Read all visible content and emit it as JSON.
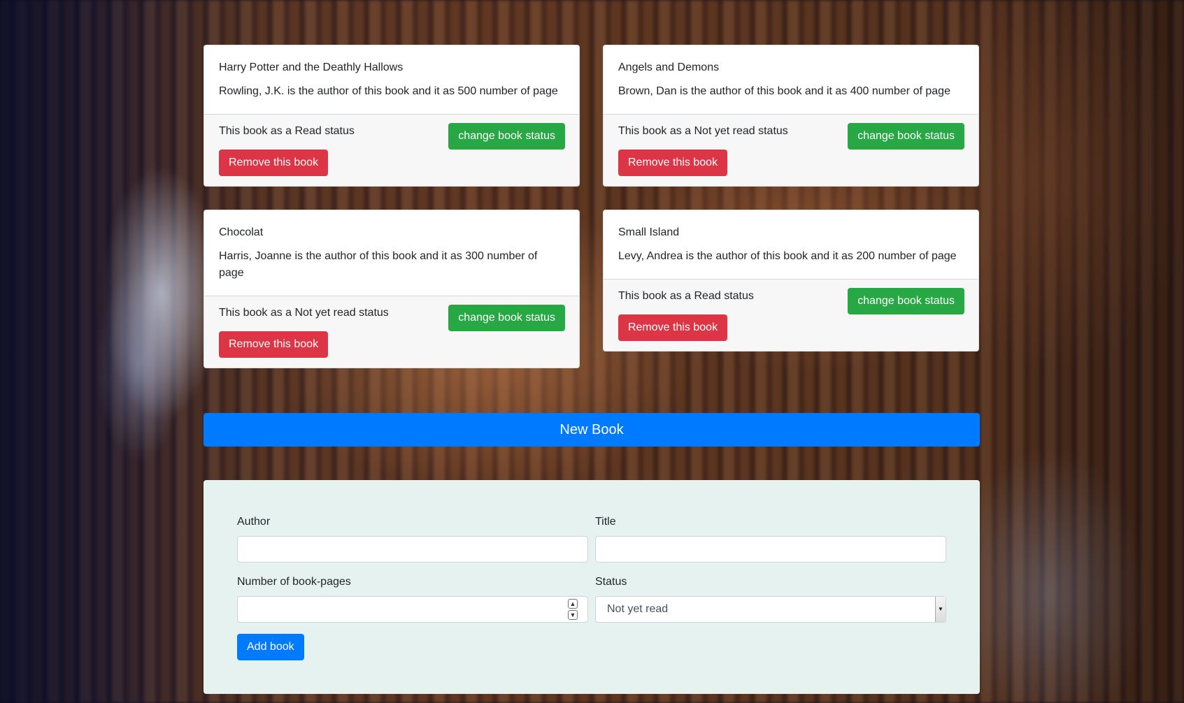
{
  "books": [
    {
      "title": "Harry Potter and the Deathly Hallows",
      "description": "Rowling, J.K. is the author of this book and it as 500 number of page",
      "status_text": "This book as a Read status",
      "change_label": "change book status",
      "remove_label": "Remove this book"
    },
    {
      "title": "Angels and Demons",
      "description": "Brown, Dan is the author of this book and it as 400 number of page",
      "status_text": "This book as a Not yet read status",
      "change_label": "change book status",
      "remove_label": "Remove this book"
    },
    {
      "title": "Chocolat",
      "description": "Harris, Joanne is the author of this book and it as 300 number of page",
      "status_text": "This book as a Not yet read status",
      "change_label": "change book status",
      "remove_label": "Remove this book"
    },
    {
      "title": "Small Island",
      "description": "Levy, Andrea is the author of this book and it as 200 number of page",
      "status_text": "This book as a Read status",
      "change_label": "change book status",
      "remove_label": "Remove this book"
    }
  ],
  "new_book_label": "New Book",
  "form": {
    "author_label": "Author",
    "author_value": "",
    "title_label": "Title",
    "title_value": "",
    "pages_label": "Number of book-pages",
    "pages_value": "",
    "status_label": "Status",
    "status_selected": "Not yet read",
    "submit_label": "Add book"
  },
  "icons": {
    "spin_up": "spin-up-icon",
    "spin_down": "spin-down-icon",
    "select_arrow": "chevron-down-icon"
  },
  "colors": {
    "primary": "#007bff",
    "success": "#28a745",
    "danger": "#dc3545",
    "form_panel": "#e6f2f0"
  }
}
